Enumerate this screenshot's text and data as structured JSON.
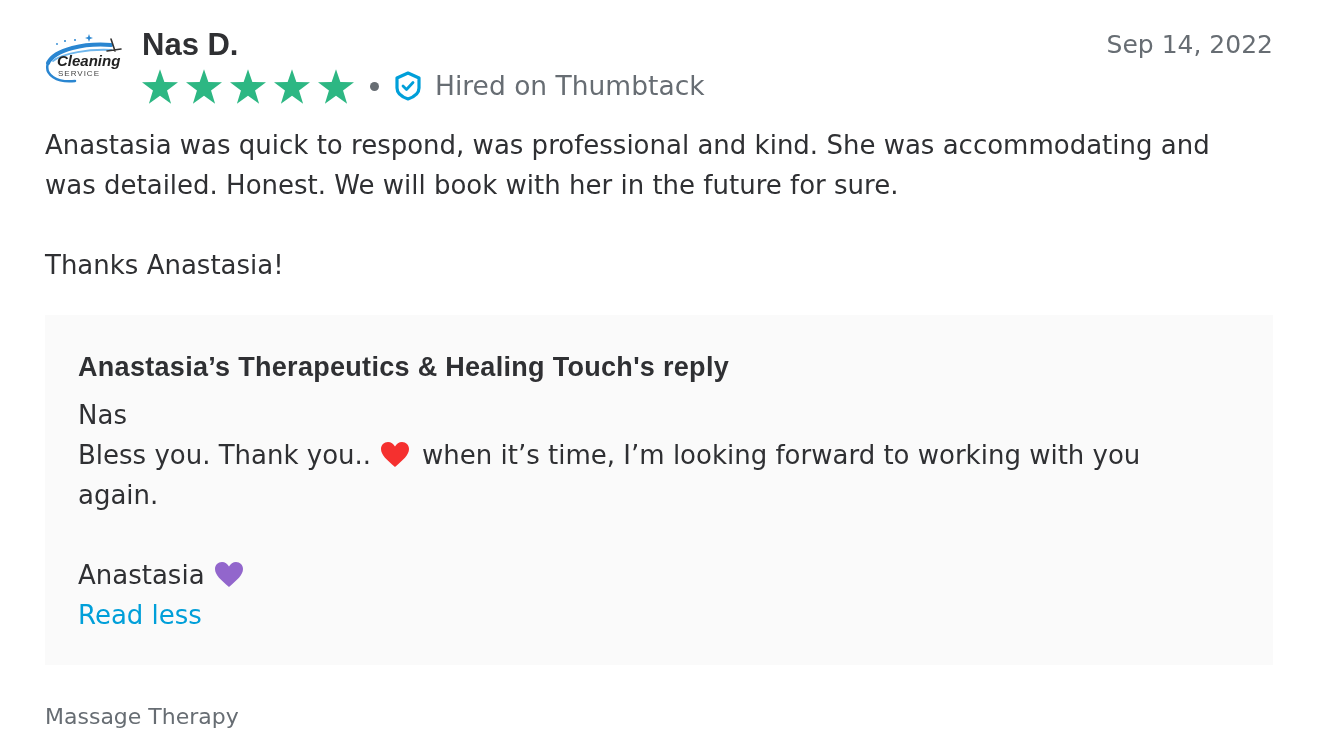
{
  "review": {
    "avatar": {
      "title": "Cleaning",
      "subtitle": "SERVICE"
    },
    "author": "Nas D.",
    "date": "Sep 14, 2022",
    "rating": {
      "stars": 5
    },
    "badge": "Hired on Thumbtack",
    "paragraphs": [
      "Anastasia was quick to respond, was professional and kind. She was accommodating and was detailed. Honest. We will book with her in the future for sure.",
      "Thanks Anastasia!"
    ]
  },
  "reply": {
    "title": "Anastasia’s Therapeutics & Healing Touch's reply",
    "paragraphs": [
      {
        "lines": [
          {
            "parts": [
              {
                "kind": "text",
                "text": "Nas"
              }
            ]
          },
          {
            "parts": [
              {
                "kind": "text",
                "text": "Bless you. Thank you.."
              },
              {
                "kind": "heart",
                "color": "#f5302f"
              },
              {
                "kind": "text",
                "text": "when it’s time, I’m looking forward to working with you again."
              }
            ]
          }
        ]
      },
      {
        "lines": [
          {
            "parts": [
              {
                "kind": "text",
                "text": "Anastasia"
              },
              {
                "kind": "heart",
                "color": "#9266cc"
              }
            ]
          }
        ]
      }
    ],
    "link": "Read less"
  },
  "service": "Massage Therapy"
}
